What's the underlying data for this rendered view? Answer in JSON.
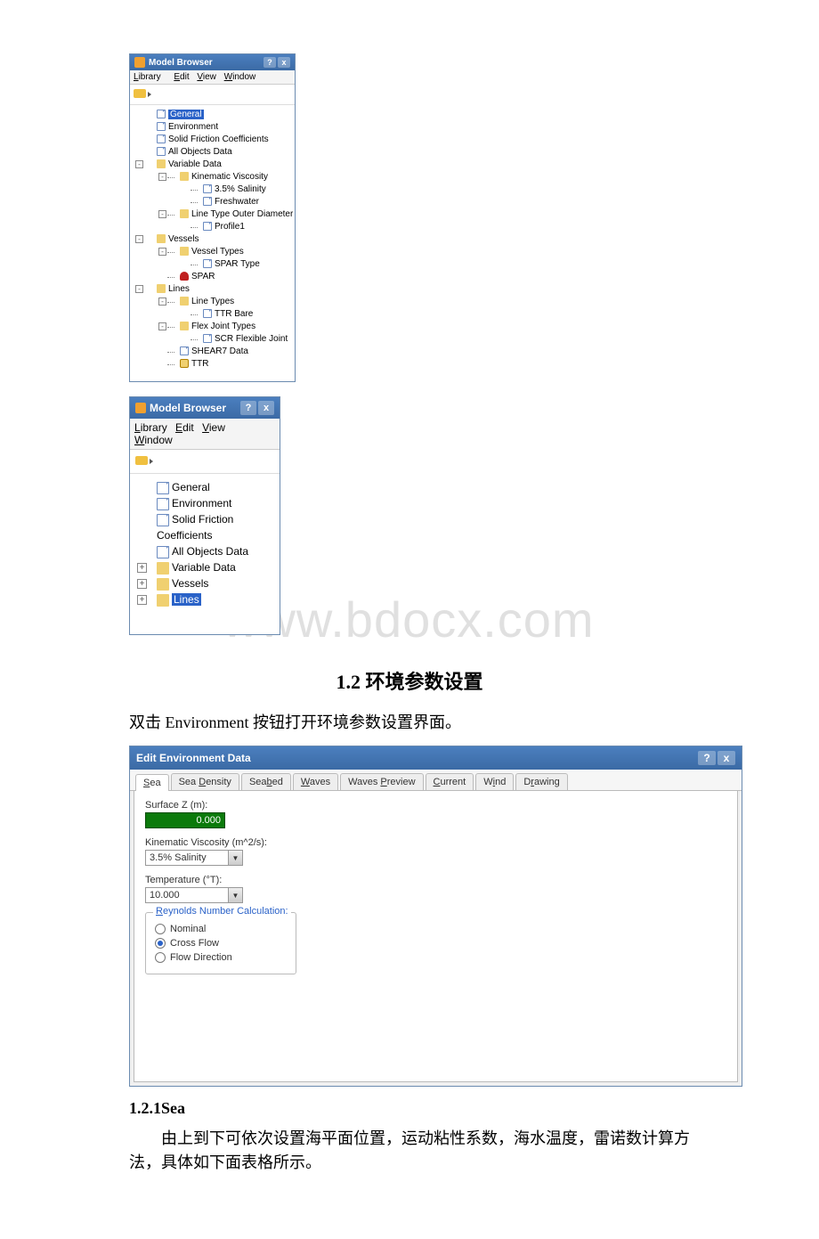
{
  "modelBrowser": {
    "title": "Model Browser",
    "menu": {
      "library": "Library",
      "edit": "Edit",
      "view": "View",
      "window": "Window"
    },
    "treeExpanded": {
      "general": "General",
      "environment": "Environment",
      "solidFriction": "Solid Friction Coefficients",
      "allObjects": "All Objects Data",
      "variableData": "Variable Data",
      "kinematicViscosity": "Kinematic Viscosity",
      "salinity35": "3.5% Salinity",
      "freshwater": "Freshwater",
      "lineTypeOuter": "Line Type Outer Diameter",
      "profile1": "Profile1",
      "vessels": "Vessels",
      "vesselTypes": "Vessel Types",
      "sparType": "SPAR Type",
      "spar": "SPAR",
      "lines": "Lines",
      "lineTypes": "Line Types",
      "ttrBare": "TTR Bare",
      "flexJointTypes": "Flex Joint Types",
      "scrFlexible": "SCR Flexible Joint",
      "shear7": "SHEAR7 Data",
      "ttr": "TTR"
    },
    "treeCollapsed": {
      "general": "General",
      "environment": "Environment",
      "solidFriction": "Solid Friction Coefficients",
      "allObjects": "All Objects Data",
      "variableData": "Variable Data",
      "vessels": "Vessels",
      "lines": "Lines"
    }
  },
  "watermark": "www.bdocx.com",
  "section": {
    "heading": "1.2 环境参数设置",
    "intro": "双击 Environment 按钮打开环境参数设置界面。",
    "sub": "1.2.1Sea",
    "body": "由上到下可依次设置海平面位置，运动粘性系数，海水温度，雷诺数计算方法，具体如下面表格所示。"
  },
  "envDialog": {
    "title": "Edit Environment Data",
    "tabs": {
      "sea": "Sea",
      "seaDensity": "Sea Density",
      "seabed": "Seabed",
      "waves": "Waves",
      "wavesPreview": "Waves Preview",
      "current": "Current",
      "wind": "Wind",
      "drawing": "Drawing"
    },
    "sea": {
      "surfaceZLabel": "Surface Z (m):",
      "surfaceZ": "0.000",
      "kvLabel": "Kinematic Viscosity (m^2/s):",
      "kvValue": "3.5% Salinity",
      "tempLabel": "Temperature (°T):",
      "tempValue": "10.000",
      "reynoldsLegend": "Reynolds Number Calculation:",
      "nominal": "Nominal",
      "crossFlow": "Cross Flow",
      "flowDirection": "Flow Direction"
    }
  }
}
